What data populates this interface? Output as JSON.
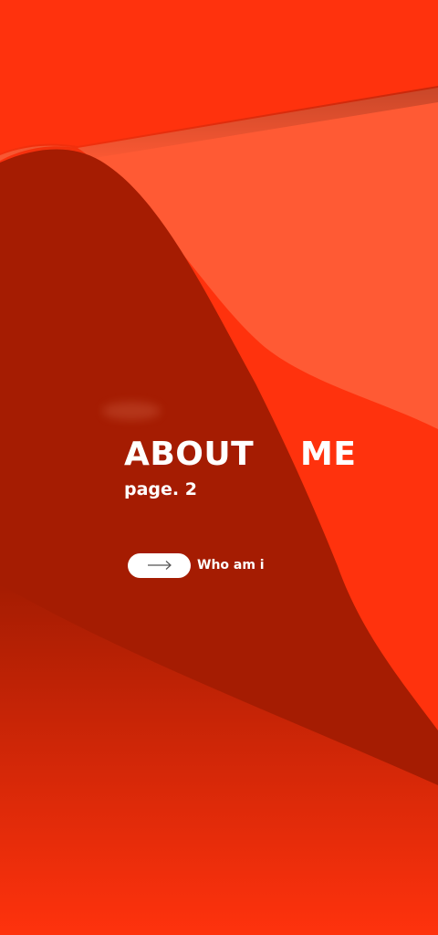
{
  "hero": {
    "title_word_1": "ABOUT",
    "title_word_2": "ME",
    "subtitle": "page. 2"
  },
  "cta": {
    "label": "Who am i",
    "icon": "arrow-right-icon"
  },
  "colors": {
    "background": "#ff320d",
    "highlight": "#ff5a34",
    "dark_fold": "#a51c02",
    "text": "#ffffff"
  }
}
